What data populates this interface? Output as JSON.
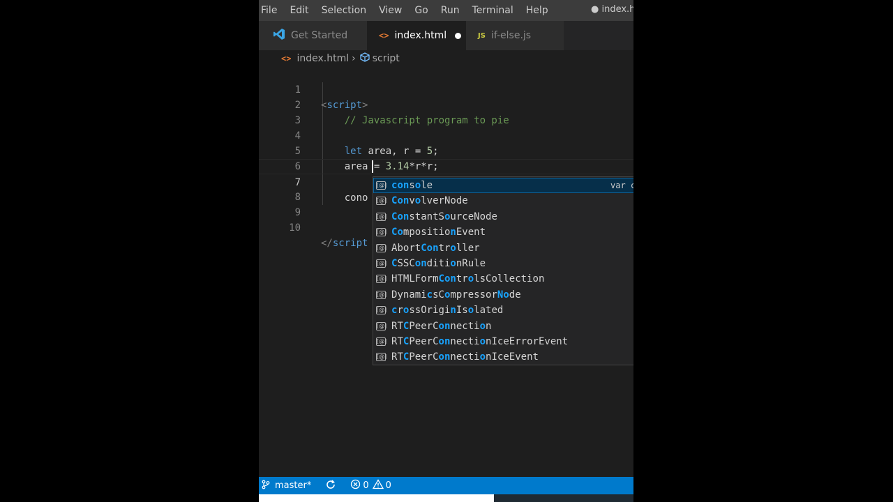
{
  "menubar": {
    "items": [
      "File",
      "Edit",
      "Selection",
      "View",
      "Go",
      "Run",
      "Terminal",
      "Help"
    ],
    "window_title": "● index.ht"
  },
  "tabs": [
    {
      "label": "Get Started",
      "icon": "vscode-logo-icon",
      "active": false
    },
    {
      "label": "index.html",
      "icon": "html-file-icon",
      "active": true,
      "dirty": true
    },
    {
      "label": "if-else.js",
      "icon": "js-file-icon",
      "active": false
    }
  ],
  "breadcrumb": {
    "file": "index.html",
    "symbol": "script"
  },
  "editor": {
    "lines": [
      {
        "num": "1",
        "text": "<script>"
      },
      {
        "num": "2",
        "text": "    // Javascript program to pie"
      },
      {
        "num": "3",
        "text": ""
      },
      {
        "num": "4",
        "text": "    let area, r = 5;"
      },
      {
        "num": "5",
        "text": "    area = 3.14*r*r;"
      },
      {
        "num": "6",
        "text": ""
      },
      {
        "num": "7",
        "text": "    cono"
      },
      {
        "num": "8",
        "text": ""
      },
      {
        "num": "9",
        "text": ""
      },
      {
        "num": "10",
        "text": "</script"
      }
    ],
    "active_line": "7"
  },
  "suggest": {
    "selected_detail": "var c",
    "items": [
      {
        "label": "console"
      },
      {
        "label": "ConvolverNode"
      },
      {
        "label": "ConstantSourceNode"
      },
      {
        "label": "CompositionEvent"
      },
      {
        "label": "AbortController"
      },
      {
        "label": "CSSConditionRule"
      },
      {
        "label": "HTMLFormControlsCollection"
      },
      {
        "label": "DynamicsCompressorNode"
      },
      {
        "label": "crossOriginIsolated"
      },
      {
        "label": "RTCPeerConnection"
      },
      {
        "label": "RTCPeerConnectionIceErrorEvent"
      },
      {
        "label": "RTCPeerConnectionIceEvent"
      }
    ]
  },
  "statusbar": {
    "branch": "master*",
    "errors": "0",
    "warnings": "0"
  },
  "colors": {
    "statusbar_bg": "#007acc",
    "menubar_bg": "#3c3c3c",
    "editor_bg": "#1e1e1e",
    "suggest_highlight": "#18a3ff"
  }
}
